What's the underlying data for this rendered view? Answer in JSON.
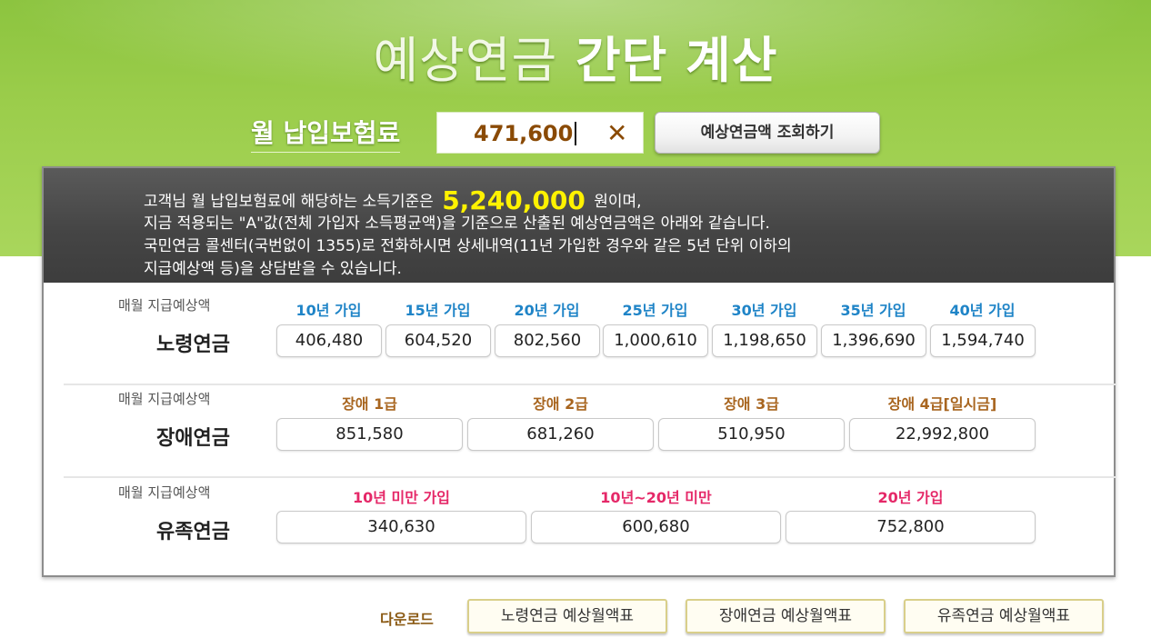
{
  "header": {
    "title_part1": "예상연금",
    "title_part2": "간단 계산"
  },
  "fee": {
    "label": "월 납입보험료",
    "value": "471,600",
    "clear_symbol": "✕",
    "query_button": "예상연금액 조회하기"
  },
  "info": {
    "line1_prefix": "고객님 월 납입보험료에 해당하는 소득기준은",
    "income": "5,240,000",
    "line1_suffix": "원이며,",
    "line2": "지금 적용되는 \"A\"값(전체 가입자 소득평균액)을 기준으로 산출된 예상연금액은 아래와 같습니다.",
    "line3": "국민연금 콜센터(국번없이 1355)로 전화하시면 상세내역(11년 가입한 경우와 같은 5년 단위 이하의",
    "line4": "지급예상액 등)을 상담받을 수 있습니다."
  },
  "sections": {
    "old_age": {
      "sub_label": "매월 지급예상액",
      "label": "노령연금",
      "headers": [
        "10년 가입",
        "15년 가입",
        "20년 가입",
        "25년 가입",
        "30년 가입",
        "35년 가입",
        "40년 가입"
      ],
      "values": [
        "406,480",
        "604,520",
        "802,560",
        "1,000,610",
        "1,198,650",
        "1,396,690",
        "1,594,740"
      ]
    },
    "disability": {
      "sub_label": "매월 지급예상액",
      "label": "장애연금",
      "headers": [
        "장애 1급",
        "장애 2급",
        "장애 3급",
        "장애 4급[일시금]"
      ],
      "values": [
        "851,580",
        "681,260",
        "510,950",
        "22,992,800"
      ]
    },
    "survivor": {
      "sub_label": "매월 지급예상액",
      "label": "유족연금",
      "headers": [
        "10년 미만 가입",
        "10년~20년 미만",
        "20년 가입"
      ],
      "values": [
        "340,630",
        "600,680",
        "752,800"
      ]
    }
  },
  "download": {
    "label": "다운로드",
    "buttons": [
      "노령연금 예상월액표",
      "장애연금 예상월액표",
      "유족연금 예상월액표"
    ]
  },
  "colors": {
    "green_bg": "#9bcd4b",
    "income_highlight": "#fff200",
    "old_age_header": "#1f84c7",
    "disability_header": "#a8651f",
    "survivor_header": "#e52868"
  }
}
